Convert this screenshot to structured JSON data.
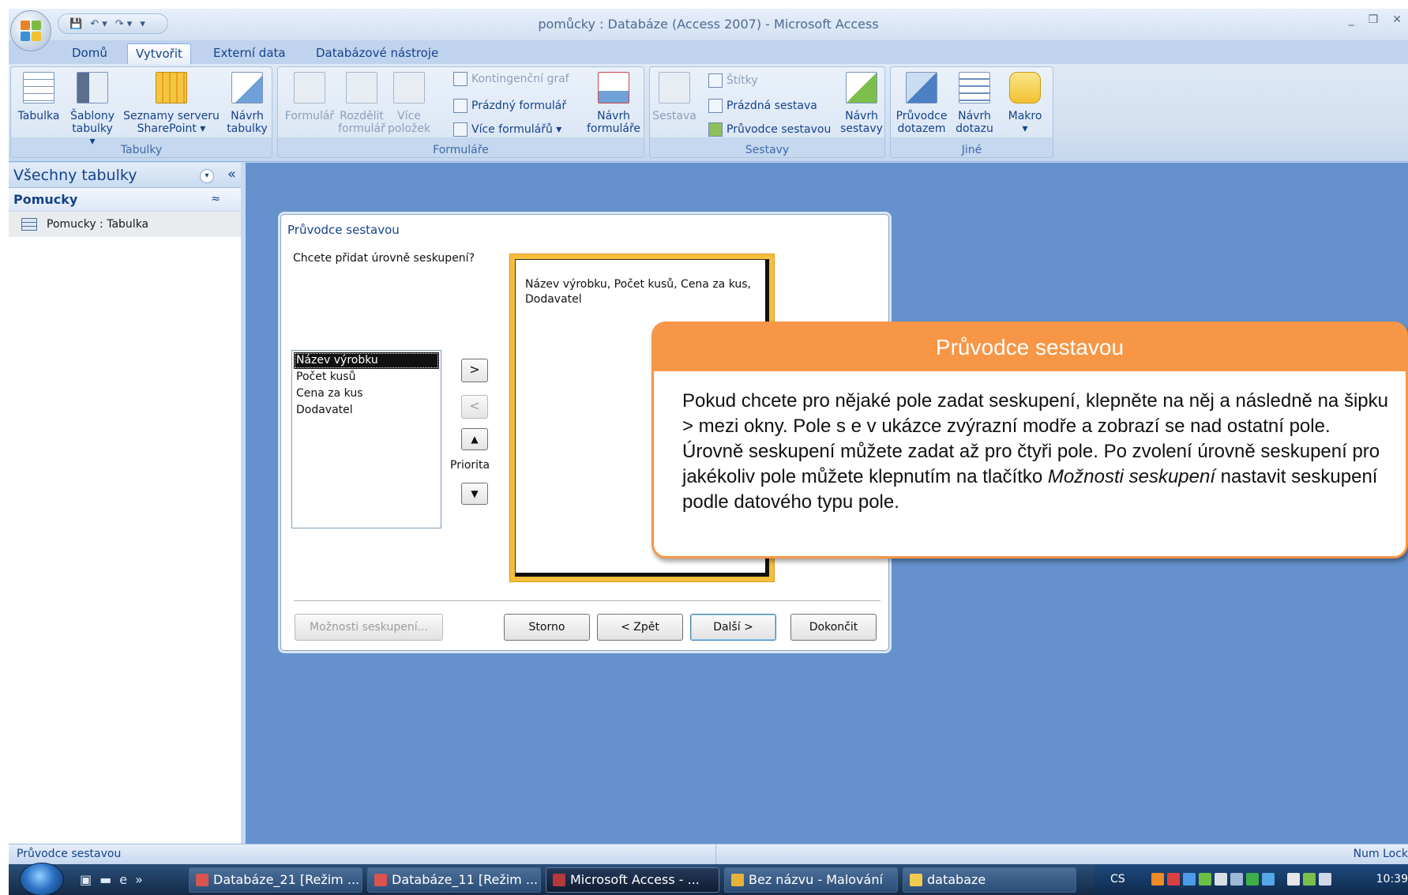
{
  "window": {
    "title": "pomůcky : Databáze (Access 2007) - Microsoft Access",
    "controls": [
      "_",
      "❐",
      "✕"
    ]
  },
  "qat": [
    "💾",
    "↶ ▾",
    "↷ ▾",
    "▾"
  ],
  "tabs": [
    "Domů",
    "Vytvořit",
    "Externí data",
    "Databázové nástroje"
  ],
  "active_tab": "Vytvořit",
  "ribbon": {
    "tabulky": {
      "label": "Tabulky",
      "buttons": [
        {
          "line1": "Tabulka",
          "line2": ""
        },
        {
          "line1": "Šablony",
          "line2": "tabulky ▾"
        },
        {
          "line1": "Seznamy serveru",
          "line2": "SharePoint ▾"
        },
        {
          "line1": "Návrh",
          "line2": "tabulky"
        }
      ]
    },
    "formulare": {
      "label": "Formuláře",
      "big": [
        {
          "line1": "Formulář",
          "line2": ""
        },
        {
          "line1": "Rozdělit",
          "line2": "formulář"
        },
        {
          "line1": "Více",
          "line2": "položek"
        }
      ],
      "small": [
        "Kontingenční graf",
        "Prázdný formulář",
        "Více formulářů ▾"
      ],
      "design": {
        "line1": "Návrh",
        "line2": "formuláře"
      }
    },
    "sestavy": {
      "label": "Sestavy",
      "big": {
        "line1": "Sestava",
        "line2": ""
      },
      "small": [
        "Štítky",
        "Prázdná sestava",
        "Průvodce sestavou"
      ],
      "design": {
        "line1": "Návrh",
        "line2": "sestavy"
      }
    },
    "jine": {
      "label": "Jiné",
      "buttons": [
        {
          "line1": "Průvodce",
          "line2": "dotazem"
        },
        {
          "line1": "Návrh",
          "line2": "dotazu"
        },
        {
          "line1": "Makro",
          "line2": "▾"
        }
      ]
    }
  },
  "nav": {
    "header": "Všechny tabulky",
    "dropdown_icon": "▾",
    "collapse_icon": "«",
    "group": "Pomucky",
    "group_chevron": "≈",
    "item": "Pomucky : Tabulka"
  },
  "wizard": {
    "title": "Průvodce sestavou",
    "question": "Chcete přidat úrovně seskupení?",
    "fields": [
      "Název výrobku",
      "Počet kusů",
      "Cena za kus",
      "Dodavatel"
    ],
    "selected_field": "Název výrobku",
    "buttons": {
      "add": ">",
      "remove": "<",
      "up": "▲",
      "down": "▼",
      "priority": "Priorita"
    },
    "preview_text": "Název výrobku, Počet kusů, Cena za kus, Dodavatel",
    "footer": {
      "options": "Možnosti seskupení...",
      "cancel": "Storno",
      "back": "< Zpět",
      "next": "Další >",
      "finish": "Dokončit"
    }
  },
  "callout": {
    "title": "Průvodce sestavou",
    "body_main": "Pokud chcete pro nějaké pole zadat seskupení, klepněte na něj a následně na šipku > mezi okny. Pole s e v ukázce zvýrazní modře a zobrazí se nad ostatní pole. Úrovně seskupení můžete zadat až pro čtyři pole. Po zvolení úrovně seskupení  pro jakékoliv pole můžete  klepnutím na tlačítko ",
    "body_italic": "Možnosti seskupení",
    "body_end": " nastavit seskupení podle datového typu pole."
  },
  "statusbar": {
    "left": "Průvodce sestavou",
    "right": "Num Lock"
  },
  "taskbar": {
    "quick_launch": [
      "▣",
      "▬",
      "e",
      "»"
    ],
    "items": [
      {
        "label": "Databáze_21 [Režim ...",
        "color": "#d9534f"
      },
      {
        "label": "Databáze_11 [Režim ...",
        "color": "#d9534f"
      },
      {
        "label": "Microsoft Access - ...",
        "color": "#b5383a"
      },
      {
        "label": "Bez názvu - Malování",
        "color": "#e8b23a"
      },
      {
        "label": "databaze",
        "color": "#f2c94c"
      }
    ],
    "lang": "CS",
    "clock": "10:39"
  },
  "colors": {
    "accent_orange": "#f79646",
    "workspace_blue": "#6591cd",
    "preview_gold": "#f5be3b"
  }
}
